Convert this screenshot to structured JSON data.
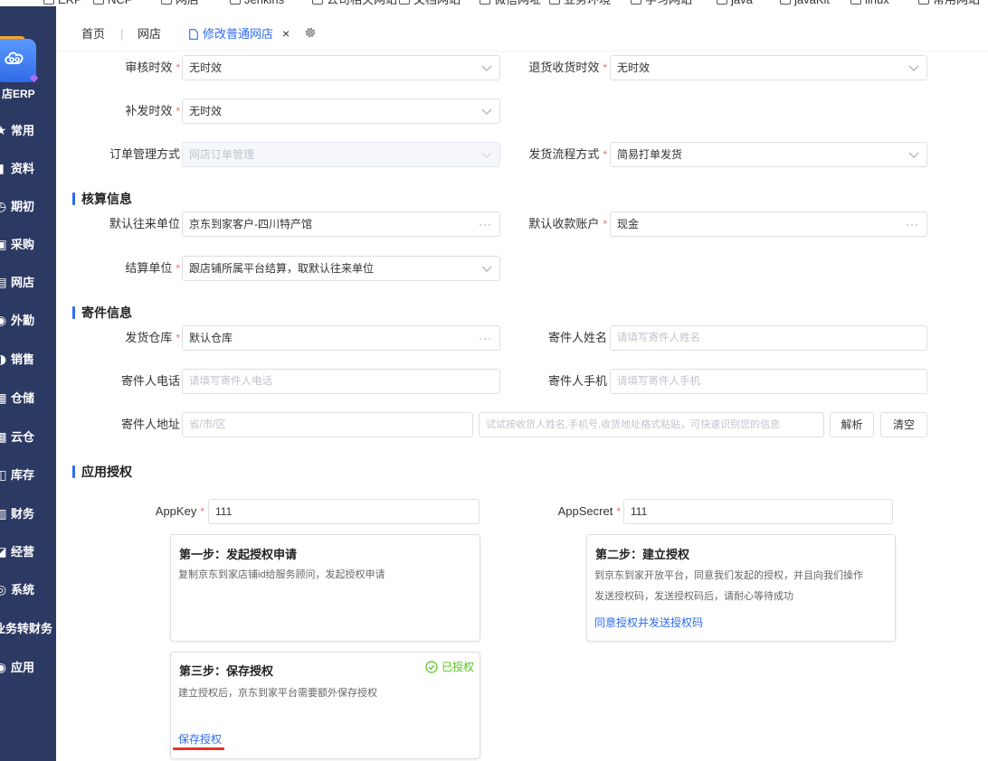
{
  "bookmarks": [
    "ERP",
    "NCF",
    "网店",
    "Jenkins",
    "公司相关网站",
    "文档网站",
    "微信网址",
    "业务环境",
    "学习网站",
    "java",
    "javaKit",
    "linux",
    "常用网站"
  ],
  "sidebar": {
    "brand": "店ERP",
    "items": [
      {
        "label": "常用",
        "icon": "star-icon"
      },
      {
        "label": "资料",
        "icon": "chart-icon"
      },
      {
        "label": "期初",
        "icon": "clock-icon"
      },
      {
        "label": "采购",
        "icon": "cart-icon"
      },
      {
        "label": "网店",
        "icon": "shop-icon"
      },
      {
        "label": "外勤",
        "icon": "location-icon"
      },
      {
        "label": "销售",
        "icon": "sales-icon"
      },
      {
        "label": "仓储",
        "icon": "warehouse-icon"
      },
      {
        "label": "云仓",
        "icon": "cloud-icon"
      },
      {
        "label": "库存",
        "icon": "inventory-icon"
      },
      {
        "label": "财务",
        "icon": "finance-icon"
      },
      {
        "label": "经营",
        "icon": "business-icon"
      },
      {
        "label": "系统",
        "icon": "system-icon"
      },
      {
        "label": "业务转财务",
        "icon": ""
      },
      {
        "label": "应用",
        "icon": "app-icon"
      }
    ]
  },
  "tabs": {
    "home": "首页",
    "separator": "|",
    "shop": "网店",
    "active": "修改普通网店",
    "close": "×"
  },
  "marks": {
    "required": "*",
    "ellipsis": "···"
  },
  "order": {
    "audit_timeliness": {
      "label": "审核时效",
      "value": "无时效",
      "required": true
    },
    "return_receipt_timeliness": {
      "label": "退货收货时效",
      "value": "无时效",
      "required": true
    },
    "reship_timeliness": {
      "label": "补发时效",
      "value": "无时效",
      "required": true
    },
    "order_management_mode": {
      "label": "订单管理方式",
      "value": "网店订单管理",
      "disabled": true
    },
    "shipping_process_mode": {
      "label": "发货流程方式",
      "value": "简易打单发货",
      "required": true
    }
  },
  "accounting": {
    "title": "核算信息",
    "default_partner": {
      "label": "默认往来单位",
      "value": "京东到家客户-四川特产馆"
    },
    "default_account": {
      "label": "默认收款账户",
      "value": "现金",
      "required": true
    },
    "settlement_unit": {
      "label": "结算单位",
      "value": "跟店铺所属平台结算，取默认往来单位",
      "required": true
    }
  },
  "sender": {
    "title": "寄件信息",
    "warehouse": {
      "label": "发货仓库",
      "value": "默认仓库",
      "required": true
    },
    "name": {
      "label": "寄件人姓名",
      "placeholder": "请填写寄件人姓名"
    },
    "phone": {
      "label": "寄件人电话",
      "placeholder": "请填写寄件人电话"
    },
    "mobile": {
      "label": "寄件人手机",
      "placeholder": "请填写寄件人手机"
    },
    "address": {
      "label": "寄件人地址",
      "region_placeholder": "省/市/区",
      "paste_placeholder": "试试按收货人姓名,手机号,收货地址格式粘贴，可快速识别您的信息",
      "parse_button": "解析",
      "clear_button": "清空"
    }
  },
  "auth": {
    "title": "应用授权",
    "app_key": {
      "label": "AppKey",
      "value": "111",
      "required": true
    },
    "app_secret": {
      "label": "AppSecret",
      "value": "111",
      "required": true
    },
    "steps": [
      {
        "title": "第一步：发起授权申请",
        "lines": [
          "复制京东到家店铺id给服务顾问，发起授权申请"
        ]
      },
      {
        "title": "第二步：建立授权",
        "lines": [
          "到京东到家开放平台，同意我们发起的授权，并且向我们操作",
          "发送授权码，发送授权码后，请耐心等待成功"
        ],
        "link": "同意授权并发送授权码"
      },
      {
        "title": "第三步：保存授权",
        "status": "已授权",
        "lines": [
          "建立授权后，京东到家平台需要额外保存授权"
        ],
        "link": "保存授权"
      }
    ]
  },
  "colors": {
    "sidebar": "#2c3a63",
    "primary": "#2f6bed",
    "required": "#f56c6c",
    "success": "#52c41a",
    "annotation": "#e5322d"
  }
}
